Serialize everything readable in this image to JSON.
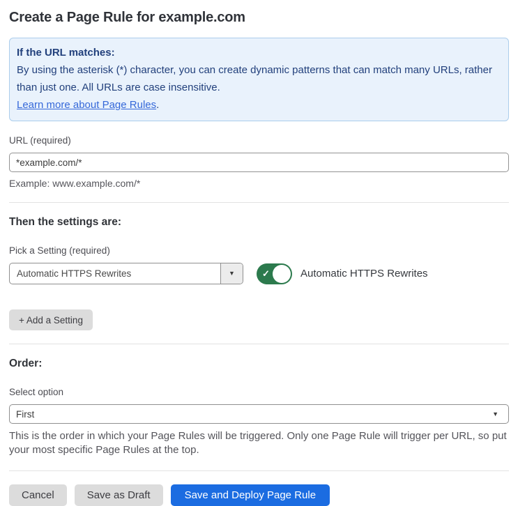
{
  "page": {
    "title": "Create a Page Rule for example.com"
  },
  "info_box": {
    "heading": "If the URL matches:",
    "body": "By using the asterisk (*) character, you can create dynamic patterns that can match many URLs, rather than just one. All URLs are case insensitive.",
    "link_text": "Learn more about Page Rules",
    "link_suffix": "."
  },
  "url_field": {
    "label": "URL (required)",
    "value": "*example.com/*",
    "helper": "Example: www.example.com/*"
  },
  "settings_section": {
    "heading": "Then the settings are:",
    "picker_label": "Pick a Setting (required)",
    "picker_value": "Automatic HTTPS Rewrites",
    "toggle_state": "on",
    "toggle_label": "Automatic HTTPS Rewrites",
    "add_setting_label": "+ Add a Setting"
  },
  "order_section": {
    "heading": "Order:",
    "select_label": "Select option",
    "select_value": "First",
    "helper": "This is the order in which your Page Rules will be triggered. Only one Page Rule will trigger per URL, so put your most specific Page Rules at the top."
  },
  "footer": {
    "cancel_label": "Cancel",
    "save_draft_label": "Save as Draft",
    "save_deploy_label": "Save and Deploy Page Rule"
  },
  "colors": {
    "accent_blue": "#1b6ce1",
    "info_bg": "#e9f2fc",
    "info_border": "#abcdec",
    "info_text": "#22407c",
    "link_blue": "#3568d9",
    "toggle_green": "#2c7a4d"
  },
  "icons": {
    "dropdown_caret": "▼",
    "toggle_check": "✓"
  }
}
